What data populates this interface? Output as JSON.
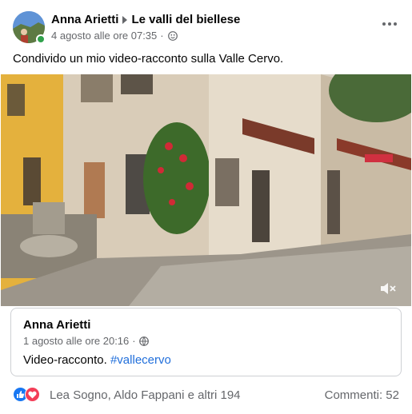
{
  "post": {
    "author": "Anna Arietti",
    "group": "Le valli del biellese",
    "timestamp": "4 agosto alle ore 07:35",
    "separator": "·",
    "text": "Condivido un mio video-racconto sulla Valle Cervo."
  },
  "shared": {
    "author": "Anna Arietti",
    "timestamp": "1 agosto alle ore 20:16",
    "separator": "·",
    "text": "Video-racconto.",
    "hashtag": "#vallecervo"
  },
  "reactions": {
    "names": "Lea Sogno, Aldo Fappani e altri 194",
    "comments": "Commenti: 52",
    "icons": [
      "like-icon",
      "love-icon"
    ]
  },
  "icons": {
    "privacy": "friends-icon",
    "shared_privacy": "globe-icon",
    "more": "more-icon",
    "mute": "speaker-muted-icon"
  },
  "colors": {
    "link": "#216fdb",
    "secondary": "#65676b",
    "like": "#1877f2",
    "love": "#f33e58",
    "online": "#31a24c"
  }
}
